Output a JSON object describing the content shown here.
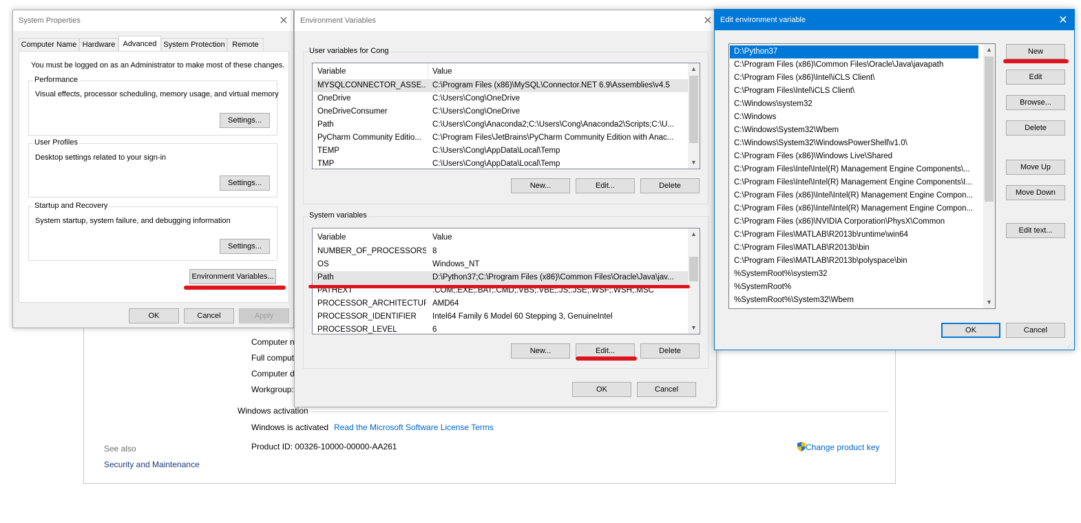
{
  "background_window": {
    "fields": [
      "Computer n",
      "Full comput",
      "Computer d",
      "Workgroup:"
    ],
    "activation_header": "Windows activation",
    "activated_text": "Windows is activated",
    "license_link": "Read the Microsoft Software License Terms",
    "product_id": "Product ID:  00326-10000-00000-AA261",
    "change_key": "Change product key",
    "see_also": "See also",
    "security_link": "Security and Maintenance"
  },
  "system_properties": {
    "title": "System Properties",
    "tabs": [
      "Computer Name",
      "Hardware",
      "Advanced",
      "System Protection",
      "Remote"
    ],
    "admin_note": "You must be logged on as an Administrator to make most of these changes.",
    "performance": {
      "label": "Performance",
      "desc": "Visual effects, processor scheduling, memory usage, and virtual memory",
      "button": "Settings..."
    },
    "user_profiles": {
      "label": "User Profiles",
      "desc": "Desktop settings related to your sign-in",
      "button": "Settings..."
    },
    "startup": {
      "label": "Startup and Recovery",
      "desc": "System startup, system failure, and debugging information",
      "button": "Settings..."
    },
    "env_button": "Environment Variables...",
    "ok": "OK",
    "cancel": "Cancel",
    "apply": "Apply"
  },
  "env_vars": {
    "title": "Environment Variables",
    "user_label": "User variables for Cong",
    "col_variable": "Variable",
    "col_value": "Value",
    "user_rows": [
      {
        "name": "MYSQLCONNECTOR_ASSE...",
        "value": "C:\\Program Files (x86)\\MySQL\\Connector.NET 6.9\\Assemblies\\v4.5"
      },
      {
        "name": "OneDrive",
        "value": "C:\\Users\\Cong\\OneDrive"
      },
      {
        "name": "OneDriveConsumer",
        "value": "C:\\Users\\Cong\\OneDrive"
      },
      {
        "name": "Path",
        "value": "C:\\Users\\Cong\\Anaconda2;C:\\Users\\Cong\\Anaconda2\\Scripts;C:\\U..."
      },
      {
        "name": "PyCharm Community Editio...",
        "value": "C:\\Program Files\\JetBrains\\PyCharm Community Edition with Anac..."
      },
      {
        "name": "TEMP",
        "value": "C:\\Users\\Cong\\AppData\\Local\\Temp"
      },
      {
        "name": "TMP",
        "value": "C:\\Users\\Cong\\AppData\\Local\\Temp"
      }
    ],
    "system_label": "System variables",
    "system_rows": [
      {
        "name": "NUMBER_OF_PROCESSORS",
        "value": "8"
      },
      {
        "name": "OS",
        "value": "Windows_NT"
      },
      {
        "name": "Path",
        "value": "D:\\Python37;C:\\Program Files (x86)\\Common Files\\Oracle\\Java\\jav..."
      },
      {
        "name": "PATHEXT",
        "value": ".COM;.EXE;.BAT;.CMD;.VBS;.VBE;.JS;.JSE;.WSF;.WSH;.MSC"
      },
      {
        "name": "PROCESSOR_ARCHITECTURE",
        "value": "AMD64"
      },
      {
        "name": "PROCESSOR_IDENTIFIER",
        "value": "Intel64 Family 6 Model 60 Stepping 3, GenuineIntel"
      },
      {
        "name": "PROCESSOR_LEVEL",
        "value": "6"
      }
    ],
    "new": "New...",
    "edit": "Edit...",
    "delete": "Delete",
    "ok": "OK",
    "cancel": "Cancel"
  },
  "edit_env": {
    "title": "Edit environment variable",
    "entries": [
      "D:\\Python37",
      "C:\\Program Files (x86)\\Common Files\\Oracle\\Java\\javapath",
      "C:\\Program Files (x86)\\Intel\\iCLS Client\\",
      "C:\\Program Files\\Intel\\iCLS Client\\",
      "C:\\Windows\\system32",
      "C:\\Windows",
      "C:\\Windows\\System32\\Wbem",
      "C:\\Windows\\System32\\WindowsPowerShell\\v1.0\\",
      "C:\\Program Files (x86)\\Windows Live\\Shared",
      "C:\\Program Files\\Intel\\Intel(R) Management Engine Components\\...",
      "C:\\Program Files\\Intel\\Intel(R) Management Engine Components\\I...",
      "C:\\Program Files (x86)\\Intel\\Intel(R) Management Engine Compon...",
      "C:\\Program Files (x86)\\Intel\\Intel(R) Management Engine Compon...",
      "C:\\Program Files (x86)\\NVIDIA Corporation\\PhysX\\Common",
      "C:\\Program Files\\MATLAB\\R2013b\\runtime\\win64",
      "C:\\Program Files\\MATLAB\\R2013b\\bin",
      "C:\\Program Files\\MATLAB\\R2013b\\polyspace\\bin",
      "%SystemRoot%\\system32",
      "%SystemRoot%",
      "%SystemRoot%\\System32\\Wbem"
    ],
    "buttons": [
      "New",
      "Edit",
      "Browse...",
      "Delete",
      "Move Up",
      "Move Down",
      "Edit text..."
    ],
    "ok": "OK",
    "cancel": "Cancel"
  },
  "colors": {
    "accent": "#0078d7",
    "highlight_mark": "#e0141e",
    "selection": "#0078d7"
  }
}
